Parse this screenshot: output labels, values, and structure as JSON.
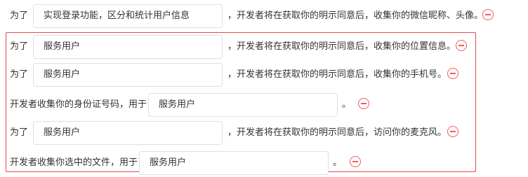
{
  "rows": [
    {
      "prefix": "为了",
      "field_value": "实现登录功能，区分和统计用户信息",
      "suffix": "，开发者将在获取你的明示同意后，收集你的微信昵称、头像。"
    },
    {
      "prefix": "为了",
      "field_value": "服务用户",
      "suffix": "，开发者将在获取你的明示同意后，收集你的位置信息。"
    },
    {
      "prefix": "为了",
      "field_value": "服务用户",
      "suffix": "，开发者将在获取你的明示同意后，收集你的手机号。"
    },
    {
      "prefix": "开发者收集你的身份证号码，用于",
      "field_value": "服务用户",
      "suffix": "。"
    },
    {
      "prefix": "为了",
      "field_value": "服务用户",
      "suffix": "，开发者将在获取你的明示同意后，访问你的麦克风。"
    },
    {
      "prefix": "开发者收集你选中的文件，用于",
      "field_value": "服务用户",
      "suffix": "。"
    }
  ],
  "colors": {
    "highlight_border": "#e04b4b",
    "remove_icon": "#f25c5c",
    "field_border": "#dcdfe6",
    "text": "#333333"
  }
}
